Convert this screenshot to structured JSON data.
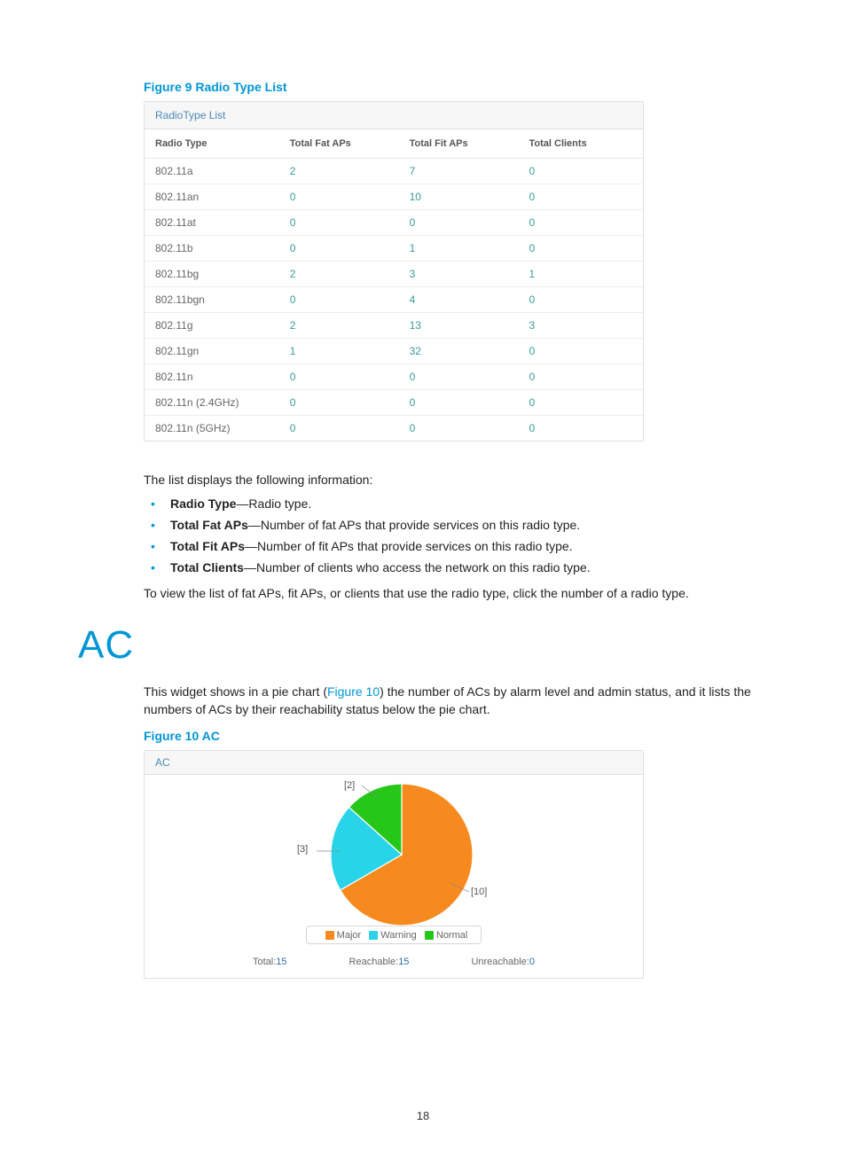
{
  "figure9": {
    "caption": "Figure 9 Radio Type List"
  },
  "radio_panel": {
    "title": "RadioType List",
    "headers": [
      "Radio Type",
      "Total Fat APs",
      "Total Fit APs",
      "Total Clients"
    ],
    "rows": [
      {
        "type": "802.11a",
        "fat": "2",
        "fit": "7",
        "clients": "0"
      },
      {
        "type": "802.11an",
        "fat": "0",
        "fit": "10",
        "clients": "0"
      },
      {
        "type": "802.11at",
        "fat": "0",
        "fit": "0",
        "clients": "0"
      },
      {
        "type": "802.11b",
        "fat": "0",
        "fit": "1",
        "clients": "0"
      },
      {
        "type": "802.11bg",
        "fat": "2",
        "fit": "3",
        "clients": "1"
      },
      {
        "type": "802.11bgn",
        "fat": "0",
        "fit": "4",
        "clients": "0"
      },
      {
        "type": "802.11g",
        "fat": "2",
        "fit": "13",
        "clients": "3"
      },
      {
        "type": "802.11gn",
        "fat": "1",
        "fit": "32",
        "clients": "0"
      },
      {
        "type": "802.11n",
        "fat": "0",
        "fit": "0",
        "clients": "0"
      },
      {
        "type": "802.11n (2.4GHz)",
        "fat": "0",
        "fit": "0",
        "clients": "0"
      },
      {
        "type": "802.11n (5GHz)",
        "fat": "0",
        "fit": "0",
        "clients": "0"
      }
    ]
  },
  "desc_intro": "The list displays the following information:",
  "desc_items": [
    {
      "term": "Radio Type",
      "rest": "—Radio type."
    },
    {
      "term": "Total Fat APs",
      "rest": "—Number of fat APs that provide services on this radio type."
    },
    {
      "term": "Total Fit APs",
      "rest": "—Number of fit APs that provide services on this radio type."
    },
    {
      "term": "Total Clients",
      "rest": "—Number of clients who access the network on this radio type."
    }
  ],
  "desc_footer": "To view the list of fat APs, fit APs, or clients that use the radio type, click the number of a radio type.",
  "section_ac": "AC",
  "ac_intro_pre": "This widget shows in a pie chart (",
  "ac_intro_link": "Figure 10",
  "ac_intro_post": ") the number of ACs by alarm level and admin status, and it lists the numbers of ACs by their reachability status below the pie chart.",
  "figure10": {
    "caption": "Figure 10 AC"
  },
  "ac_panel": {
    "title": "AC",
    "callouts": {
      "major": "[10]",
      "warning": "[3]",
      "normal": "[2]"
    },
    "legend": {
      "major": "Major",
      "warning": "Warning",
      "normal": "Normal"
    },
    "stats": {
      "total_label": "Total:",
      "total_value": "15",
      "reach_label": "Reachable:",
      "reach_value": "15",
      "unreach_label": "Unreachable:",
      "unreach_value": "0"
    }
  },
  "chart_data": {
    "type": "pie",
    "title": "AC",
    "series": [
      {
        "name": "Major",
        "value": 10,
        "color": "#f78a1e"
      },
      {
        "name": "Warning",
        "value": 3,
        "color": "#2ad4e8"
      },
      {
        "name": "Normal",
        "value": 2,
        "color": "#26c719"
      }
    ],
    "summary": {
      "Total": 15,
      "Reachable": 15,
      "Unreachable": 0
    }
  },
  "page_number": "18"
}
